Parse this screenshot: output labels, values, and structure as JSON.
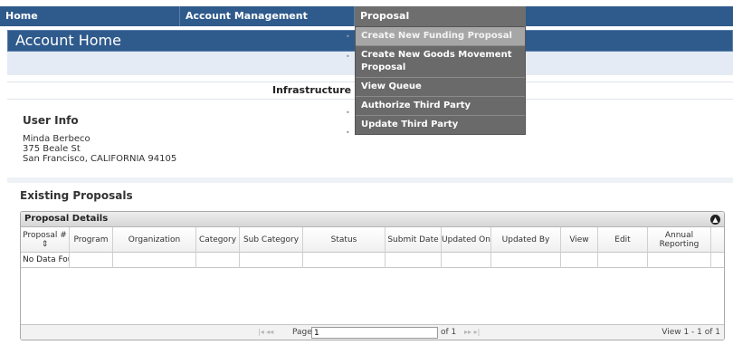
{
  "nav": {
    "home": "Home",
    "account_management": "Account Management",
    "proposal": "Proposal"
  },
  "dropdown": {
    "items": [
      "Create New Funding Proposal",
      "Create New Goods Movement Proposal",
      "View Queue",
      "Authorize Third Party",
      "Update Third Party"
    ]
  },
  "page": {
    "title": "Account Home",
    "section_heading": "Infrastructure",
    "bullet": "•"
  },
  "user_info": {
    "title": "User Info",
    "name": "Minda Berbeco",
    "street": "375 Beale St",
    "city_state_zip": "San Francisco, CALIFORNIA 94105"
  },
  "proposals": {
    "title": "Existing Proposals",
    "caption": "Proposal Details",
    "columns": [
      "Proposal # ⇕",
      "Program",
      "Organization",
      "Category",
      "Sub Category",
      "Status",
      "Submit Date",
      "Updated On",
      "Updated By",
      "View",
      "Edit",
      "Annual Reporting"
    ],
    "empty_row": "No Data Found"
  },
  "pager": {
    "first_prev": "|◂ ◂◂",
    "page_label": "Page",
    "page_value": "1",
    "of_label": "of 1",
    "next_last": "▸▸ ▸|",
    "view_summary": "View 1 - 1 of 1"
  },
  "colors": {
    "nav_blue": "#2f5a8c",
    "menu_gray": "#6a6a6a",
    "menu_active": "#a6a6a6"
  }
}
